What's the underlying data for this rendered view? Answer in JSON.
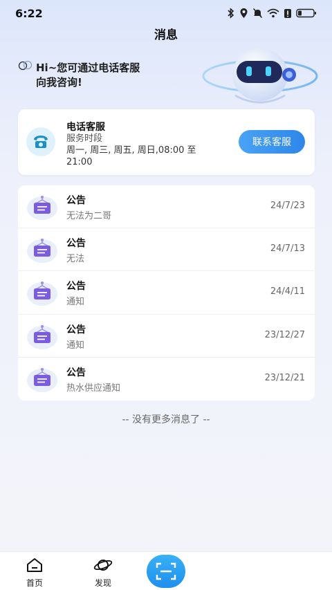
{
  "status_bar": {
    "time": "6:22",
    "icons": [
      "bluetooth-icon",
      "location-icon",
      "mute-icon",
      "wifi-icon",
      "alert-icon",
      "battery-icon"
    ]
  },
  "header": {
    "title": "消息"
  },
  "hero": {
    "greeting_line1": "Hi~您可通过电话客服",
    "greeting_line2": "向我咨询!"
  },
  "phone_service": {
    "title": "电话客服",
    "subtitle": "服务时段",
    "hours": "周一, 周三, 周五, 周日,08:00 至 21:00",
    "button_label": "联系客服"
  },
  "messages": [
    {
      "title": "公告",
      "preview": "无法为二哥",
      "date": "24/7/23"
    },
    {
      "title": "公告",
      "preview": "无法",
      "date": "24/7/13"
    },
    {
      "title": "公告",
      "preview": "通知",
      "date": "24/4/11"
    },
    {
      "title": "公告",
      "preview": "通知",
      "date": "23/12/27"
    },
    {
      "title": "公告",
      "preview": "热水供应通知",
      "date": "23/12/21"
    }
  ],
  "list_footer": "-- 没有更多消息了 --",
  "bottom_nav": {
    "home_label": "首页",
    "discover_label": "发现"
  },
  "colors": {
    "accent": "#2d86ea",
    "scan": "#1e8fec",
    "notice_icon": "#7b5ce0"
  }
}
